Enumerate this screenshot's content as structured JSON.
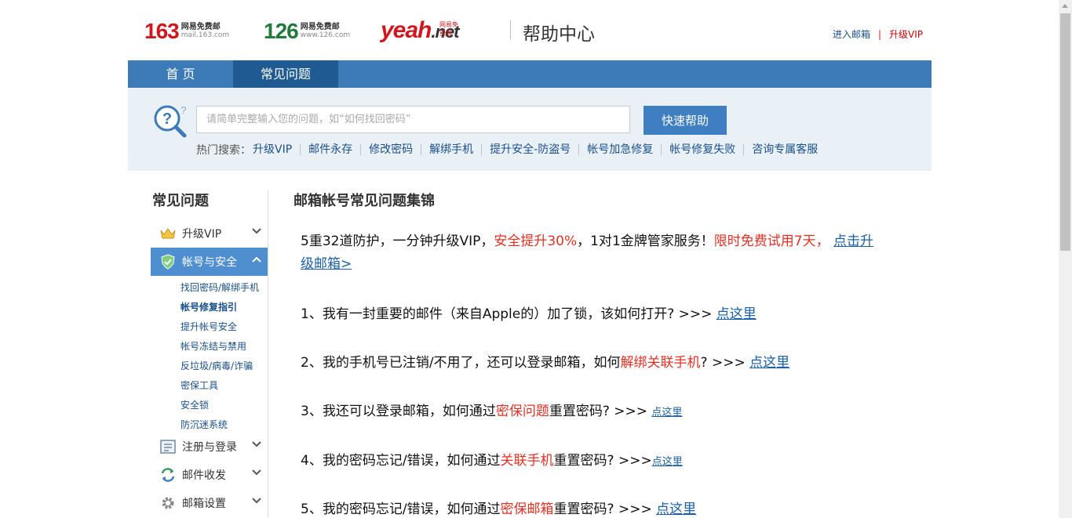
{
  "header": {
    "logo163": {
      "big": "163",
      "line1": "网易免费邮",
      "line2": "mail.163.com"
    },
    "logo126": {
      "big": "126",
      "line1": "网易免费邮",
      "line2": "www.126.com"
    },
    "logoyeah": {
      "big": "yeah",
      "net": ".net",
      "tag": "网易免费邮"
    },
    "help_title": "帮助中心",
    "enter_mail": "进入邮箱",
    "separator": "|",
    "upgrade_vip": "升级VIP"
  },
  "nav": {
    "home": "首 页",
    "faq": "常见问题"
  },
  "search": {
    "placeholder": "请简单完整输入您的问题，如“如何找回密码”",
    "button": "快速帮助",
    "hot_label": "热门搜索：",
    "hot_links": [
      "升级VIP",
      "邮件永存",
      "修改密码",
      "解绑手机",
      "提升安全-防盗号",
      "帐号加急修复",
      "帐号修复失败",
      "咨询专属客服"
    ]
  },
  "sidebar": {
    "title": "常见问题",
    "items": [
      {
        "label": "升级VIP",
        "icon": "crown-icon"
      },
      {
        "label": "帐号与安全",
        "icon": "shield-icon"
      },
      {
        "label": "注册与登录",
        "icon": "form-icon"
      },
      {
        "label": "邮件收发",
        "icon": "sync-icon"
      },
      {
        "label": "邮箱设置",
        "icon": "gear-icon"
      }
    ],
    "subitems": [
      "找回密码/解绑手机",
      "帐号修复指引",
      "提升帐号安全",
      "帐号冻结与禁用",
      "反垃圾/病毒/诈骗",
      "密保工具",
      "安全锁",
      "防沉迷系统"
    ]
  },
  "main": {
    "title": "邮箱帐号常见问题集锦",
    "promo": {
      "t1": "5重32道防护，一分钟升级VIP，",
      "t2": "安全提升30%",
      "t3": "，1对1金牌管家服务！",
      "t4": "限时免费试用7天，",
      "link1": "点击升",
      "link2": "级邮箱>"
    },
    "q1": {
      "text": "1、我有一封重要的邮件（来自Apple的）加了锁，该如何打开? >>> ",
      "link": "点这里"
    },
    "q2": {
      "t1": "2、我的手机号已注销/不用了，还可以登录邮箱，如何",
      "red": "解绑关联手机",
      "t2": "? >>> ",
      "link": "点这里"
    },
    "q3": {
      "t1": "3、我还可以登录邮箱，如何通过",
      "red": "密保问题",
      "t2": "重置密码? >>> ",
      "link": "点这里"
    },
    "q4": {
      "t1": "4、我的密码忘记/错误，如何通过",
      "red": "关联手机",
      "t2": "重置密码? >>>",
      "link": "点这里"
    },
    "q5": {
      "t1": "5、我的密码忘记/错误，如何通过",
      "red": "密保邮箱",
      "t2": "重置密码? >>> ",
      "link": "点这里"
    }
  }
}
